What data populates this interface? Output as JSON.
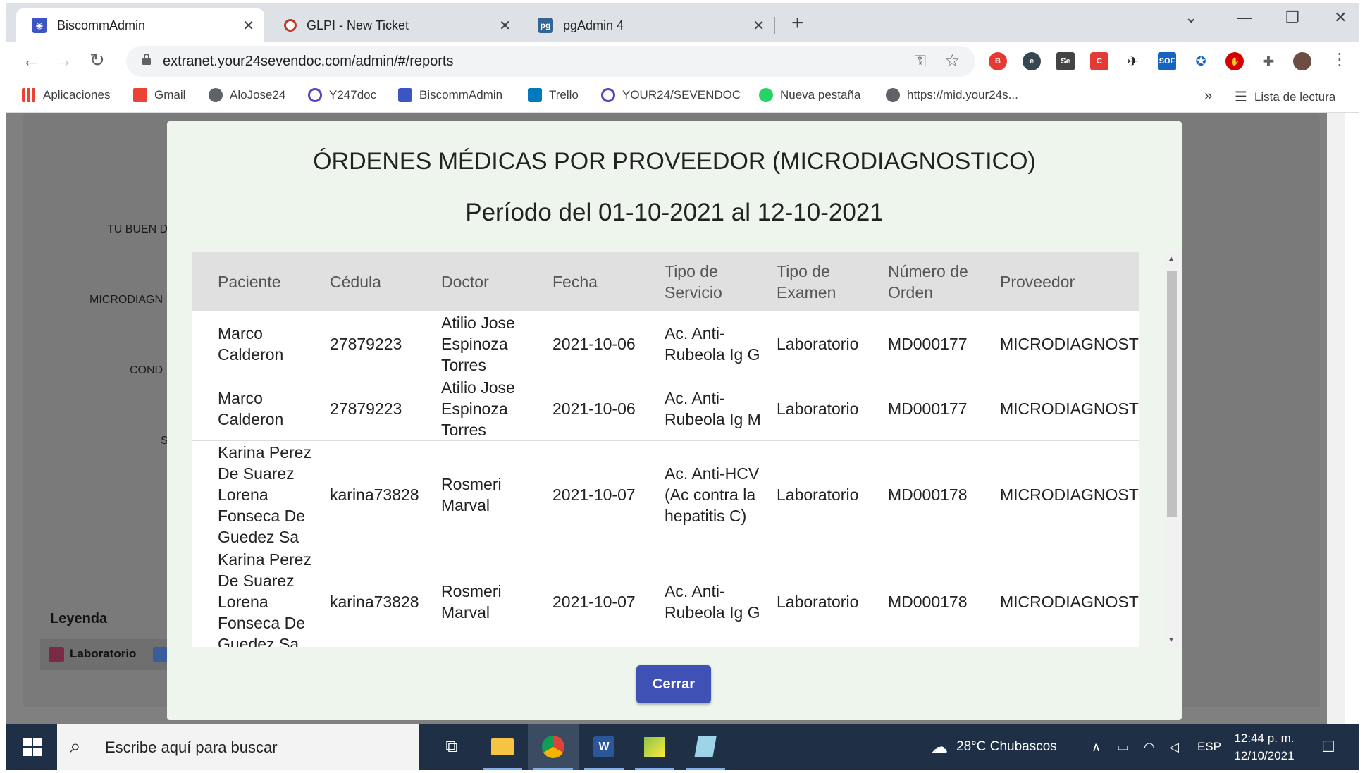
{
  "browser": {
    "tabs": [
      {
        "title": "BiscommAdmin",
        "active": true
      },
      {
        "title": "GLPI - New Ticket",
        "active": false
      },
      {
        "title": "pgAdmin 4",
        "active": false
      }
    ],
    "url": "extranet.your24sevendoc.com/admin/#/reports",
    "bookmarks": [
      "Aplicaciones",
      "Gmail",
      "AloJose24",
      "Y247doc",
      "BiscommAdmin",
      "Trello",
      "YOUR24/SEVENDOC",
      "Nueva pestaña",
      "https://mid.your24s..."
    ],
    "reading_list": "Lista de lectura",
    "more_bookmarks": "»"
  },
  "background": {
    "labels": [
      "TU BUEN D",
      "MICRODIAGN",
      "COND",
      "S"
    ],
    "legend_title": "Leyenda",
    "legend_items": [
      {
        "label": "Laboratorio",
        "color": "#7a2a46"
      },
      {
        "label": "",
        "color": "#3a5d9a"
      }
    ]
  },
  "modal": {
    "title": "ÓRDENES MÉDICAS POR PROVEEDOR (MICRODIAGNOSTICO)",
    "period": "Período del 01-10-2021 al 12-10-2021",
    "columns": [
      [
        "Paciente"
      ],
      [
        "Cédula"
      ],
      [
        "Doctor"
      ],
      [
        "Fecha"
      ],
      [
        "Tipo de",
        "Servicio"
      ],
      [
        "Tipo de",
        "Examen"
      ],
      [
        "Número de",
        "Orden"
      ],
      [
        "Proveedor"
      ]
    ],
    "rows": [
      {
        "paciente": [
          "Marco",
          "Calderon"
        ],
        "cedula": "27879223",
        "doctor": [
          "Atilio Jose",
          "Espinoza",
          "Torres"
        ],
        "fecha": "2021-10-06",
        "servicio": [
          "Ac. Anti-",
          "Rubeola Ig G"
        ],
        "examen": "Laboratorio",
        "orden": "MD000177",
        "proveedor": "MICRODIAGNOSTI"
      },
      {
        "paciente": [
          "Marco",
          "Calderon"
        ],
        "cedula": "27879223",
        "doctor": [
          "Atilio Jose",
          "Espinoza",
          "Torres"
        ],
        "fecha": "2021-10-06",
        "servicio": [
          "Ac. Anti-",
          "Rubeola Ig M"
        ],
        "examen": "Laboratorio",
        "orden": "MD000177",
        "proveedor": "MICRODIAGNOSTI"
      },
      {
        "paciente": [
          "Karina Perez",
          "De Suarez",
          "Lorena",
          "Fonseca De",
          "Guedez Sa"
        ],
        "cedula": "karina73828",
        "doctor": [
          "Rosmeri",
          "Marval"
        ],
        "fecha": "2021-10-07",
        "servicio": [
          "Ac. Anti-HCV",
          "(Ac contra la",
          "hepatitis C)"
        ],
        "examen": "Laboratorio",
        "orden": "MD000178",
        "proveedor": "MICRODIAGNOSTI"
      },
      {
        "paciente": [
          "Karina Perez",
          "De Suarez",
          "Lorena",
          "Fonseca De",
          "Guedez Sa"
        ],
        "cedula": "karina73828",
        "doctor": [
          "Rosmeri",
          "Marval"
        ],
        "fecha": "2021-10-07",
        "servicio": [
          "Ac. Anti-",
          "Rubeola Ig G"
        ],
        "examen": "Laboratorio",
        "orden": "MD000178",
        "proveedor": "MICRODIAGNOSTI"
      }
    ],
    "close_label": "Cerrar"
  },
  "taskbar": {
    "search_placeholder": "Escribe aquí para buscar",
    "weather": "28°C  Chubascos",
    "language": "ESP",
    "time": "12:44 p. m.",
    "date": "12/10/2021"
  }
}
